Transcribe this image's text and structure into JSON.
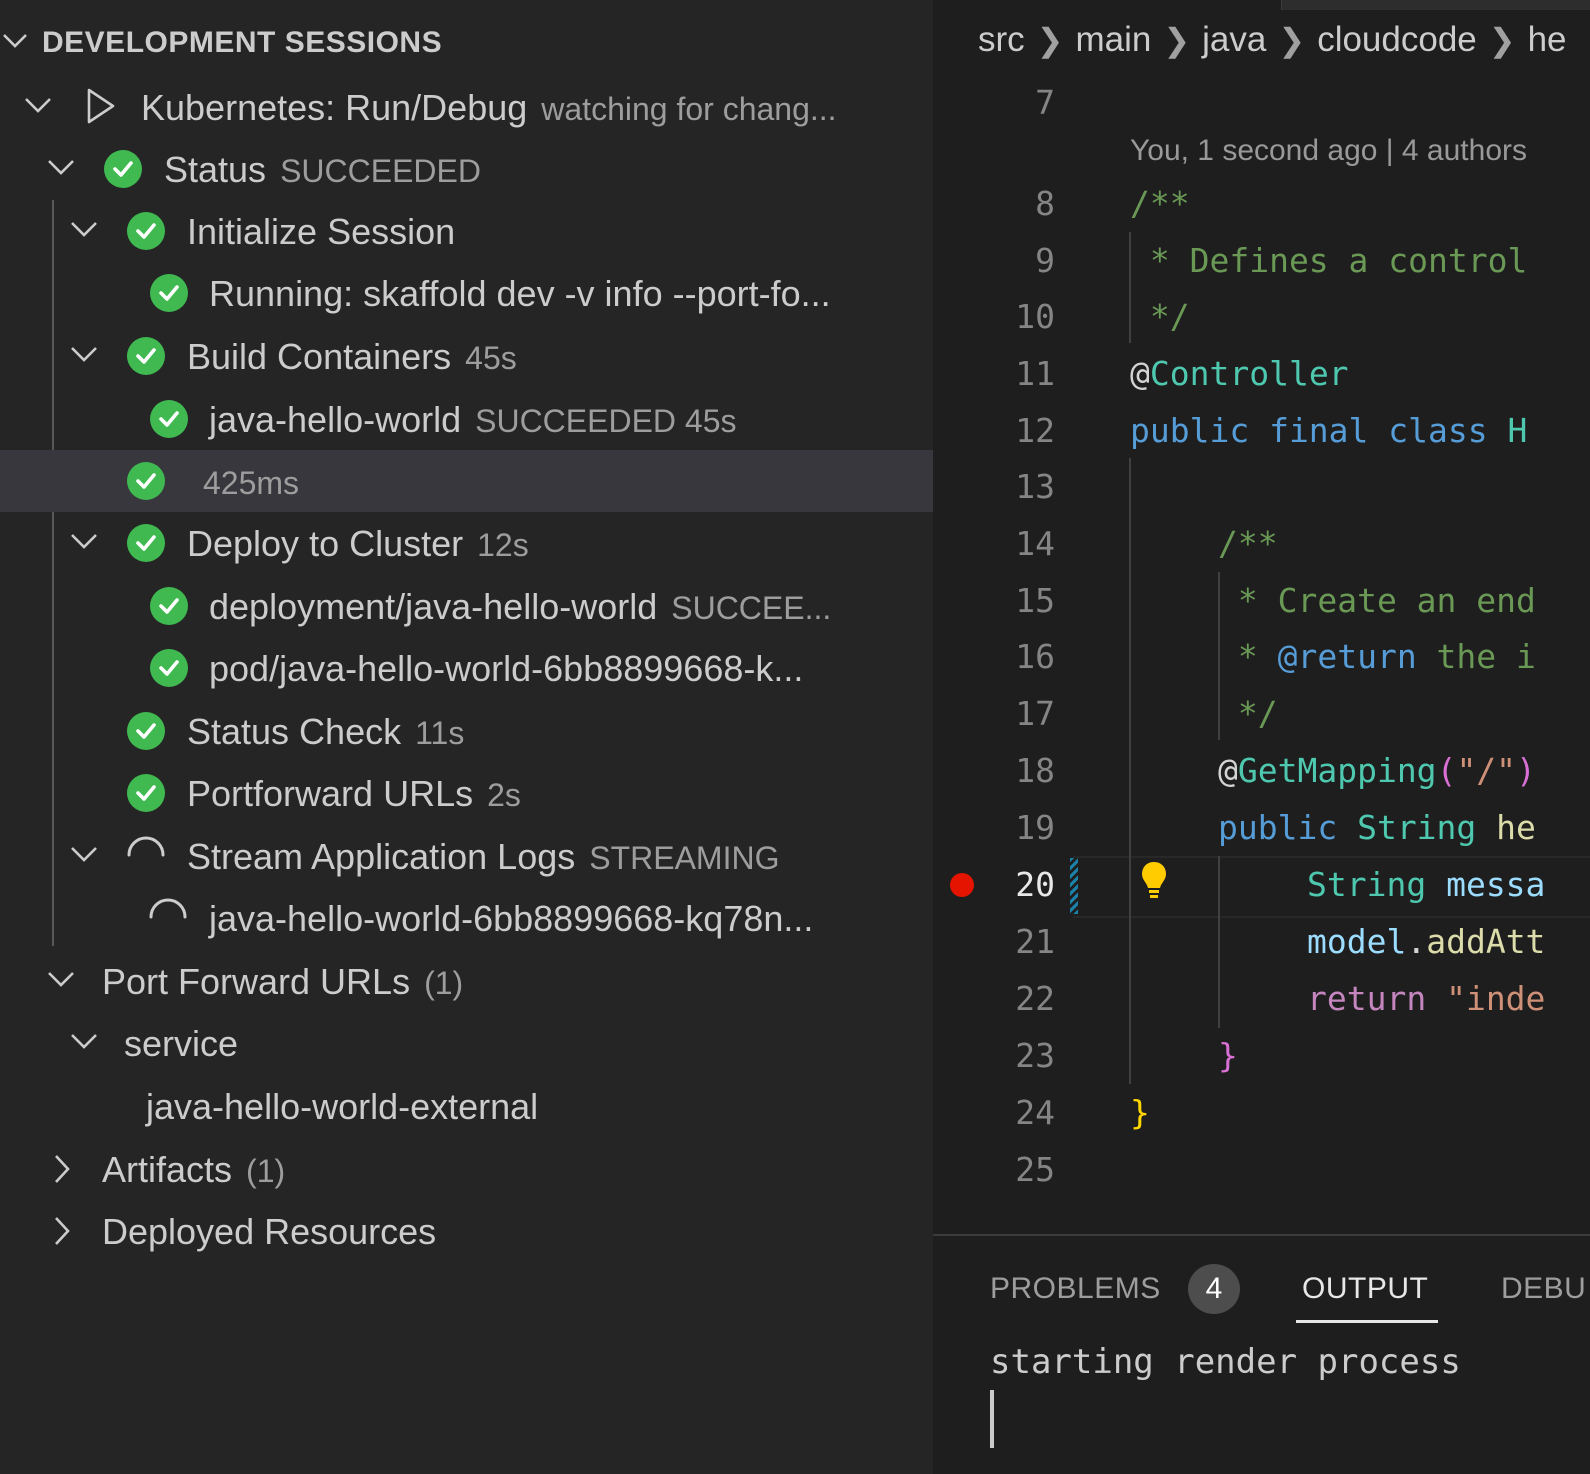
{
  "sidebar": {
    "section_title": "DEVELOPMENT SESSIONS",
    "rows": [
      {
        "label": "Kubernetes: Run/Debug",
        "desc": "watching for chang..."
      },
      {
        "label": "Status",
        "desc": "SUCCEEDED"
      },
      {
        "label": "Initialize Session",
        "desc": ""
      },
      {
        "label": "Running: skaffold dev -v info --port-fo...",
        "desc": ""
      },
      {
        "label": "Build Containers",
        "desc": "45s"
      },
      {
        "label": "java-hello-world",
        "desc": "SUCCEEDED 45s"
      },
      {
        "label": "",
        "desc": "425ms"
      },
      {
        "label": "Deploy to Cluster",
        "desc": "12s"
      },
      {
        "label": "deployment/java-hello-world",
        "desc": "SUCCEE..."
      },
      {
        "label": "pod/java-hello-world-6bb8899668-k...",
        "desc": ""
      },
      {
        "label": "Status Check",
        "desc": "11s"
      },
      {
        "label": "Portforward URLs",
        "desc": "2s"
      },
      {
        "label": "Stream Application Logs",
        "desc": "STREAMING"
      },
      {
        "label": "java-hello-world-6bb8899668-kq78n...",
        "desc": ""
      },
      {
        "label": "Port Forward URLs",
        "desc": "(1)"
      },
      {
        "label": "service",
        "desc": ""
      },
      {
        "label": "java-hello-world-external",
        "desc": ""
      },
      {
        "label": "Artifacts",
        "desc": "(1)"
      },
      {
        "label": "Deployed Resources",
        "desc": ""
      }
    ]
  },
  "editor": {
    "breadcrumb": [
      "src",
      "main",
      "java",
      "cloudcode",
      "he"
    ],
    "codelens": "You, 1 second ago | 4 authors",
    "line_numbers": [
      "7",
      "8",
      "9",
      "10",
      "11",
      "12",
      "13",
      "14",
      "15",
      "16",
      "17",
      "18",
      "19",
      "20",
      "21",
      "22",
      "23",
      "24",
      "25"
    ],
    "active_line": "20",
    "code": {
      "l8": "/**",
      "l9": " * Defines a control",
      "l10": " */",
      "l11_at": "@",
      "l11_ann": "Controller",
      "l12_kw": "public final class ",
      "l12_rest": "H",
      "l14": "/**",
      "l15": " * Create an end",
      "l16_star": " * ",
      "l16_tag": "@return",
      "l16_rest": " the i",
      "l17": " */",
      "l18_at": "@",
      "l18_ann": "GetMapping",
      "l18_paren": "(",
      "l18_str": "\"/\"",
      "l18_close": ")",
      "l19_kw": "public ",
      "l19_type": "String ",
      "l19_fn": "he",
      "l20_type": "String ",
      "l20_var": "messa",
      "l21_var": "model",
      "l21_dot": ".",
      "l21_fn": "addAtt",
      "l22_kw": "return ",
      "l22_str": "\"inde",
      "l23": "}",
      "l24": "}"
    }
  },
  "panel": {
    "tabs": [
      "PROBLEMS",
      "OUTPUT",
      "DEBU"
    ],
    "problems_count": "4",
    "output_text": "starting render process"
  },
  "colors": {
    "success": "#3fb950",
    "breakpoint": "#e51400",
    "bulb": "#ffcc00"
  }
}
